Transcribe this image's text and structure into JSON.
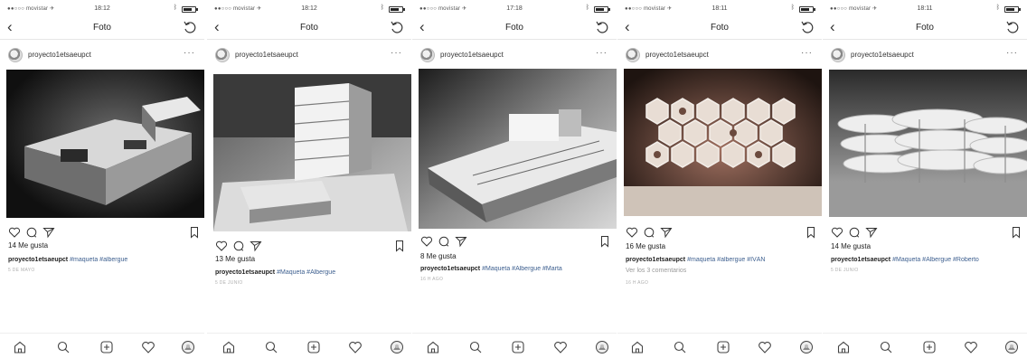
{
  "colors": {
    "hashtag": "#3d5f8f",
    "text": "#222222",
    "muted": "#9a9a9a",
    "background": "#ffffff"
  },
  "icons": {
    "navbar": [
      "back-chevron-icon",
      "refresh-icon"
    ],
    "post_actions": [
      "heart-icon",
      "comment-icon",
      "send-icon",
      "bookmark-icon"
    ],
    "tabbar": [
      "home-icon",
      "search-icon",
      "add-post-icon",
      "activity-heart-icon",
      "profile-avatar-icon"
    ]
  },
  "screens": [
    {
      "status": {
        "carrier": "●●○○○ movistar ✈",
        "time": "18:12"
      },
      "nav": {
        "back": "‹",
        "title": "Foto"
      },
      "post": {
        "username": "proyecto1etsaeupct",
        "more": "···",
        "likes": "14 Me gusta",
        "caption_user": "proyecto1etsaeupct",
        "caption_tags": "#maqueta #albergue",
        "comments": "",
        "date": "5 DE MAYO"
      }
    },
    {
      "status": {
        "carrier": "●●○○○ movistar ✈",
        "time": "18:12"
      },
      "nav": {
        "back": "‹",
        "title": "Foto"
      },
      "post": {
        "username": "proyecto1etsaeupct",
        "more": "···",
        "likes": "13 Me gusta",
        "caption_user": "proyecto1etsaeupct",
        "caption_tags": "#Maqueta #Albergue",
        "comments": "",
        "date": "5 DE JUNIO"
      }
    },
    {
      "status": {
        "carrier": "●●○○○ movistar ✈",
        "time": "17:18"
      },
      "nav": {
        "back": "‹",
        "title": "Foto"
      },
      "post": {
        "username": "proyecto1etsaeupct",
        "more": "···",
        "likes": "8 Me gusta",
        "caption_user": "proyecto1etsaeupct",
        "caption_tags": "#Maqueta #Albergue #Marta",
        "comments": "",
        "date": "16 H AGO"
      }
    },
    {
      "status": {
        "carrier": "●●○○○ movistar ✈",
        "time": "18:11"
      },
      "nav": {
        "back": "‹",
        "title": "Foto"
      },
      "post": {
        "username": "proyecto1etsaeupct",
        "more": "···",
        "likes": "16 Me gusta",
        "caption_user": "proyecto1etsaeupct",
        "caption_tags": "#maqueta #albergue #IVÁN",
        "comments": "Ver los 3 comentarios",
        "date": "16 H AGO"
      }
    },
    {
      "status": {
        "carrier": "●●○○○ movistar ✈",
        "time": "18:11"
      },
      "nav": {
        "back": "‹",
        "title": "Foto"
      },
      "post": {
        "username": "proyecto1etsaeupct",
        "more": "···",
        "likes": "14 Me gusta",
        "caption_user": "proyecto1etsaeupct",
        "caption_tags": "#Maqueta #Albergue #Roberto",
        "comments": "",
        "date": "5 DE JUNIO"
      }
    }
  ]
}
